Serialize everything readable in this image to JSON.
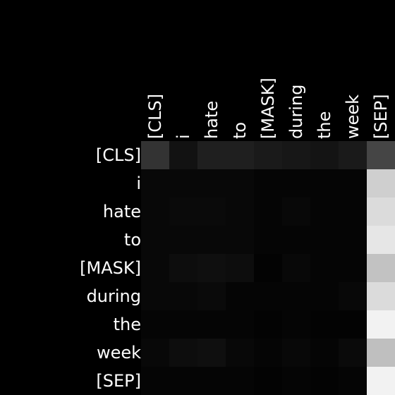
{
  "chart_data": {
    "type": "heatmap",
    "x_labels": [
      "[CLS]",
      "i",
      "hate",
      "to",
      "[MASK]",
      "during",
      "the",
      "week",
      "[SEP]"
    ],
    "y_labels": [
      "[CLS]",
      "i",
      "hate",
      "to",
      "[MASK]",
      "during",
      "the",
      "week",
      "[SEP]"
    ],
    "values": [
      [
        0.2,
        0.07,
        0.12,
        0.12,
        0.1,
        0.09,
        0.08,
        0.1,
        0.27
      ],
      [
        0.03,
        0.03,
        0.03,
        0.03,
        0.02,
        0.02,
        0.02,
        0.02,
        0.81
      ],
      [
        0.03,
        0.04,
        0.04,
        0.03,
        0.02,
        0.03,
        0.02,
        0.02,
        0.86
      ],
      [
        0.03,
        0.03,
        0.03,
        0.03,
        0.02,
        0.02,
        0.02,
        0.02,
        0.9
      ],
      [
        0.03,
        0.05,
        0.06,
        0.05,
        0.01,
        0.03,
        0.02,
        0.02,
        0.76
      ],
      [
        0.03,
        0.03,
        0.04,
        0.02,
        0.02,
        0.02,
        0.02,
        0.03,
        0.86
      ],
      [
        0.02,
        0.02,
        0.02,
        0.02,
        0.01,
        0.02,
        0.01,
        0.01,
        0.95
      ],
      [
        0.03,
        0.05,
        0.06,
        0.03,
        0.02,
        0.03,
        0.02,
        0.04,
        0.75
      ],
      [
        0.02,
        0.02,
        0.02,
        0.02,
        0.01,
        0.02,
        0.01,
        0.02,
        0.95
      ]
    ],
    "colormap": "grayscale",
    "background": "#000000",
    "label_color": "#ffffff"
  }
}
